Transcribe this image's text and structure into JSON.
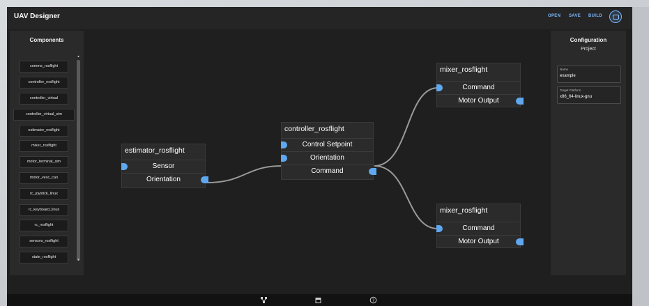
{
  "app": {
    "title": "UAV Designer",
    "actions": [
      "OPEN",
      "SAVE",
      "BUILD"
    ],
    "avatar_icon": "user-avatar-icon"
  },
  "components_panel": {
    "title": "Components",
    "items": [
      "comms_rosflight",
      "controller_rosflight",
      "controller_virtual",
      "controller_virtual_sim",
      "estimator_rosflight",
      "mixer_rosflight",
      "motor_terminal_sim",
      "motor_vesc_can",
      "rc_joystick_linux",
      "rc_keyboard_linux",
      "rc_rosflight",
      "sensors_rosflight",
      "state_rosflight"
    ]
  },
  "config_panel": {
    "title": "Configuration",
    "subtitle": "Project",
    "fields": [
      {
        "label": "Name",
        "value": "example"
      },
      {
        "label": "Target Platform",
        "value": "x86_64-linux-gnu"
      }
    ]
  },
  "nodes": {
    "estimator": {
      "title": "estimator_rosflight",
      "inputs": [
        "Sensor"
      ],
      "outputs": [
        "Orientation"
      ]
    },
    "controller": {
      "title": "controller_rosflight",
      "inputs": [
        "Control Setpoint",
        "Orientation"
      ],
      "outputs": [
        "Command"
      ]
    },
    "mixer_top": {
      "title": "mixer_rosflight",
      "inputs": [
        "Command"
      ],
      "outputs": [
        "Motor Output"
      ]
    },
    "mixer_bottom": {
      "title": "mixer_rosflight",
      "inputs": [
        "Command"
      ],
      "outputs": [
        "Motor Output"
      ]
    }
  },
  "connections": [
    {
      "from": "estimator.Orientation",
      "to": "controller.Orientation"
    },
    {
      "from": "controller.Command",
      "to": "mixer_top.Command"
    },
    {
      "from": "controller.Command",
      "to": "mixer_bottom.Command"
    }
  ],
  "bottom_bar": {
    "icons": [
      "graph-editor-icon",
      "store-icon",
      "help-icon"
    ]
  },
  "colors": {
    "accent": "#7cb7ff",
    "port": "#5fa7ee",
    "wire": "#9a9a9a",
    "background": "#1f1f1f",
    "panel": "#2a2a2a"
  }
}
